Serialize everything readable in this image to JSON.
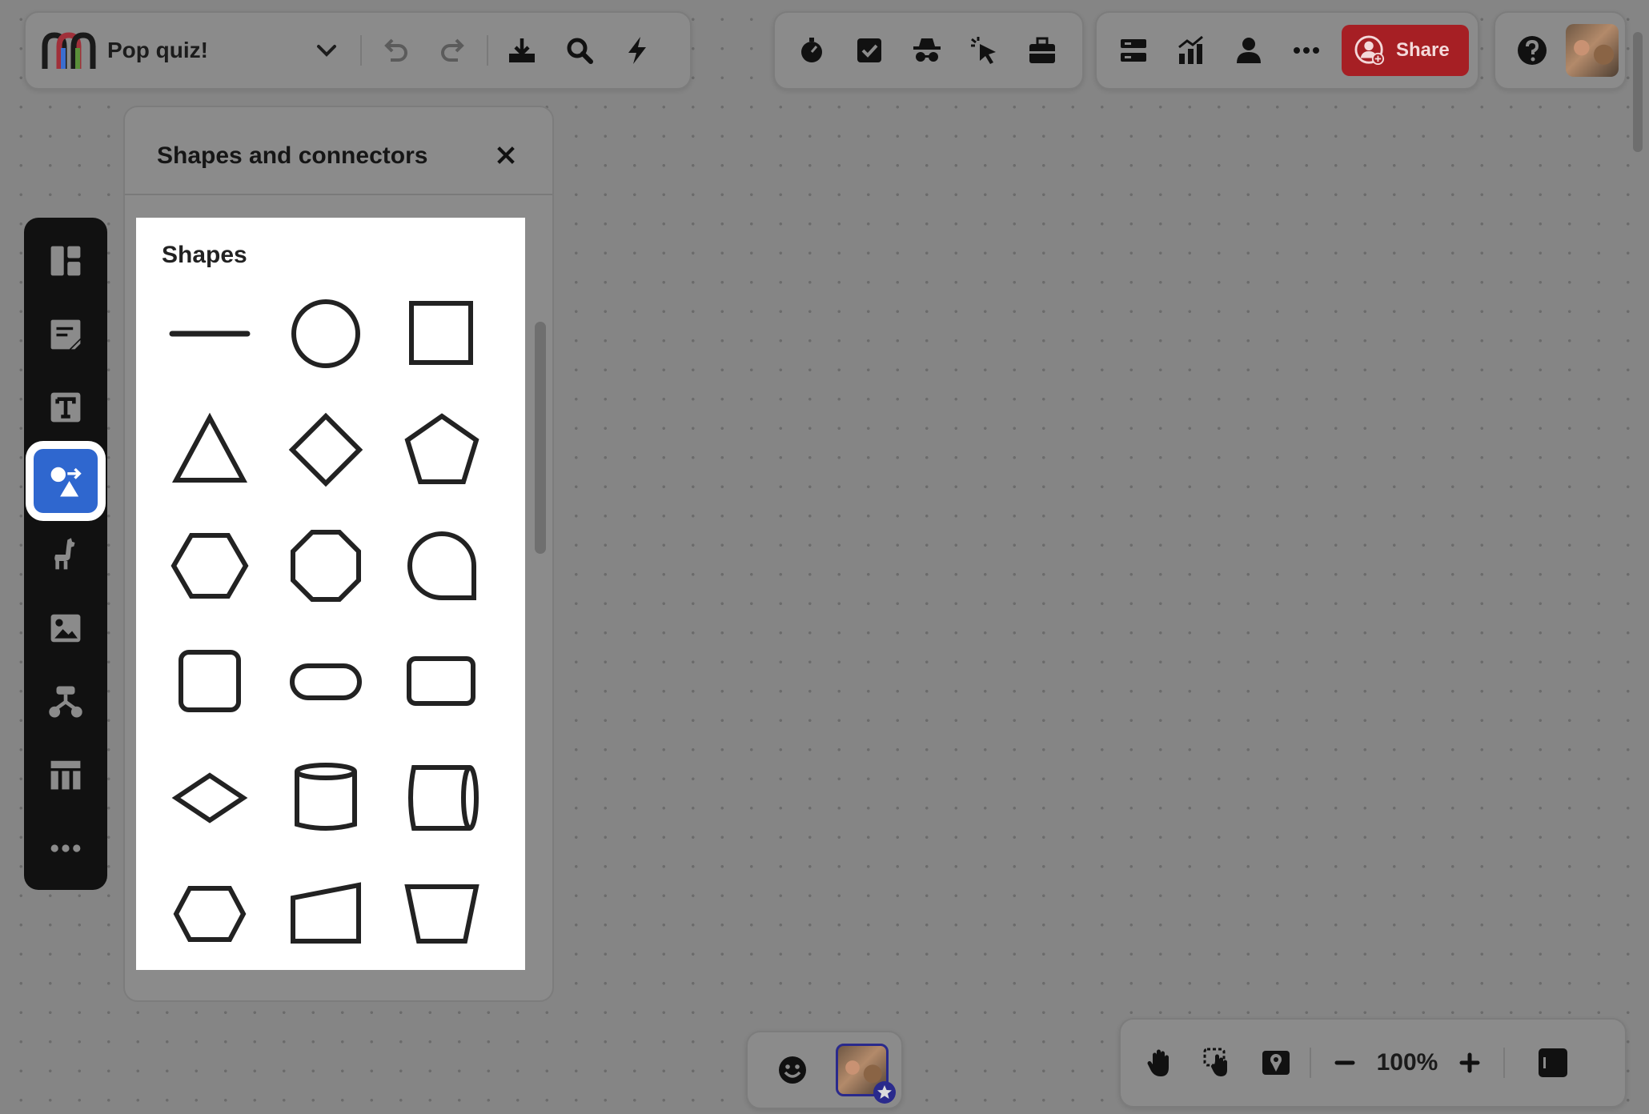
{
  "header": {
    "board_title": "Pop quiz!",
    "icons": [
      "logo-icon",
      "chevron-down-icon",
      "undo-icon",
      "redo-icon",
      "download-icon",
      "search-icon",
      "lightning-icon"
    ]
  },
  "collab_toolbar": {
    "icons": [
      "timer-icon",
      "vote-icon",
      "private-mode-icon",
      "cursor-icon",
      "toolbox-icon"
    ]
  },
  "view_toolbar": {
    "icons": [
      "layout-icon",
      "chart-icon",
      "person-icon",
      "more-icon"
    ],
    "share_label": "Share"
  },
  "help": {
    "icon": "help-icon"
  },
  "left_rail": {
    "items": [
      "templates-icon",
      "sticky-note-icon",
      "text-icon",
      "shapes-icon",
      "llama-icon",
      "image-icon",
      "diagram-icon",
      "table-icon",
      "more-icon"
    ],
    "active": "shapes-icon"
  },
  "shapes_panel": {
    "title": "Shapes and connectors",
    "section_title": "Shapes",
    "shapes": [
      "line",
      "circle",
      "square",
      "triangle",
      "diamond",
      "pentagon",
      "hexagon",
      "octagon",
      "speech-bubble",
      "rounded-square",
      "pill",
      "rounded-rectangle",
      "rhombus",
      "cylinder",
      "horizontal-cylinder",
      "flat-hexagon",
      "slanted-quadrilateral",
      "trapezoid"
    ]
  },
  "bottom_center": {
    "icons": [
      "emoji-icon",
      "avatar-icon"
    ]
  },
  "bottom_right": {
    "icons": [
      "hand-icon",
      "select-hand-icon",
      "map-icon",
      "zoom-out-icon",
      "zoom-in-icon",
      "panel-toggle-icon"
    ],
    "zoom": "100%"
  },
  "colors": {
    "accent": "#2f67cf",
    "share": "#a61f24",
    "rail": "#111111"
  }
}
